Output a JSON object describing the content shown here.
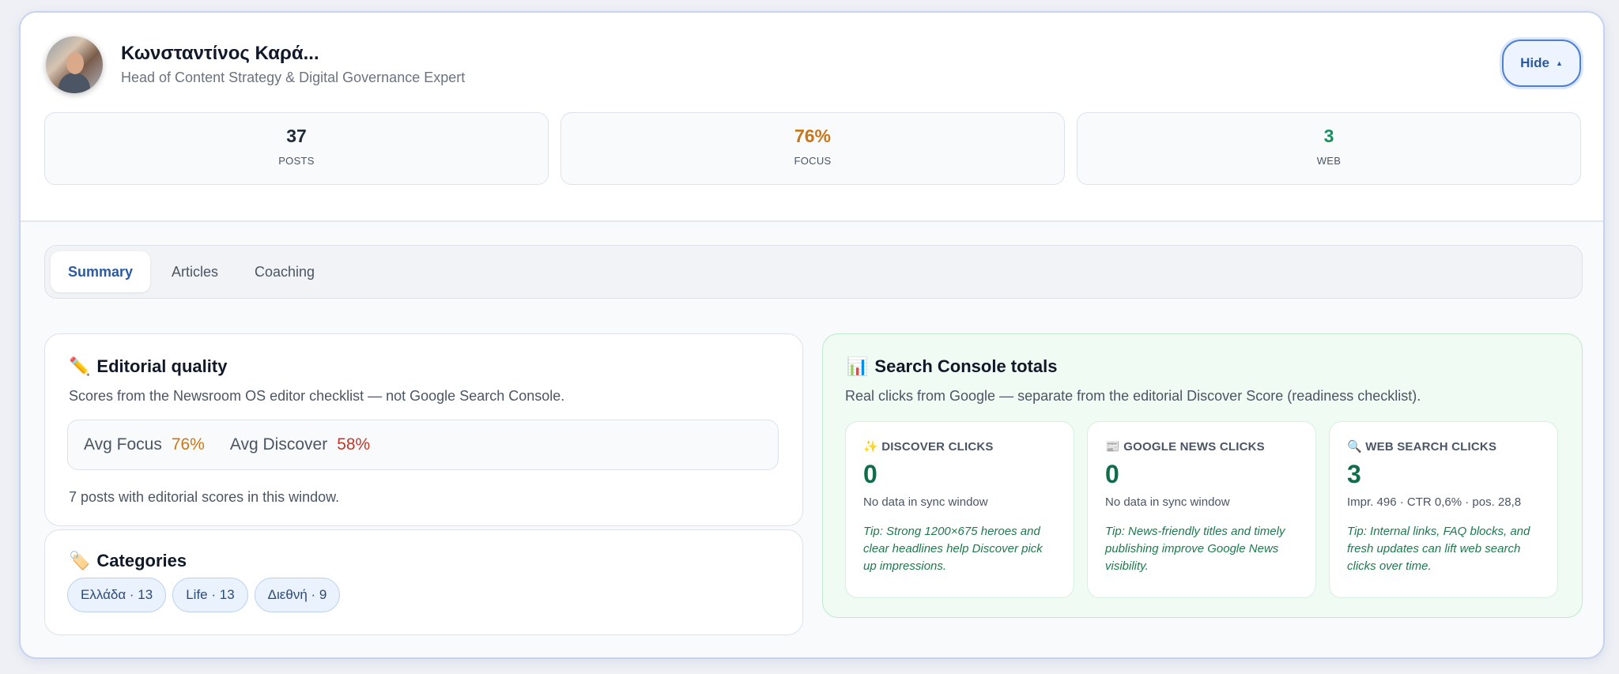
{
  "profile": {
    "name": "Κωνσταντίνος Καρά...",
    "role": "Head of Content Strategy & Digital Governance Expert",
    "hide_label": "Hide"
  },
  "stats": [
    {
      "value": "37",
      "label": "POSTS",
      "color": "#111827"
    },
    {
      "value": "76%",
      "label": "FOCUS",
      "color": "#c7771a"
    },
    {
      "value": "3",
      "label": "WEB",
      "color": "#15905e"
    }
  ],
  "tabs": [
    {
      "label": "Summary",
      "active": true
    },
    {
      "label": "Articles",
      "active": false
    },
    {
      "label": "Coaching",
      "active": false
    }
  ],
  "editorial": {
    "icon": "pencil-icon",
    "title": "Editorial quality",
    "subtitle": "Scores from the Newsroom OS editor checklist — not Google Search Console.",
    "avg_focus_label": "Avg Focus",
    "avg_focus_value": "76%",
    "avg_discover_label": "Avg Discover",
    "avg_discover_value": "58%",
    "note": "7 posts with editorial scores in this window."
  },
  "categories": {
    "icon": "tag-icon",
    "title": "Categories",
    "items": [
      "Ελλάδα · 13",
      "Life · 13",
      "Διεθνή · 9"
    ]
  },
  "search_console": {
    "icon": "bar-chart-icon",
    "title": "Search Console totals",
    "subtitle": "Real clicks from Google — separate from the editorial Discover Score (readiness checklist).",
    "cards": [
      {
        "icon": "sparkles-icon",
        "title": "DISCOVER CLICKS",
        "value": "0",
        "detail": "No data in sync window",
        "tip": "Tip: Strong 1200×675 heroes and clear headlines help Discover pick up impressions."
      },
      {
        "icon": "newspaper-icon",
        "title": "GOOGLE NEWS CLICKS",
        "value": "0",
        "detail": "No data in sync window",
        "tip": "Tip: News-friendly titles and timely publishing improve Google News visibility."
      },
      {
        "icon": "magnifier-icon",
        "title": "WEB SEARCH CLICKS",
        "value": "3",
        "detail": "Impr. 496 · CTR 0,6% · pos. 28,8",
        "tip": "Tip: Internal links, FAQ blocks, and fresh updates can lift web search clicks over time."
      }
    ]
  },
  "colors": {
    "focus": "#c7771a",
    "discover": "#c0392b",
    "accent": "#2c5aa0",
    "green": "#0f6e4a"
  }
}
